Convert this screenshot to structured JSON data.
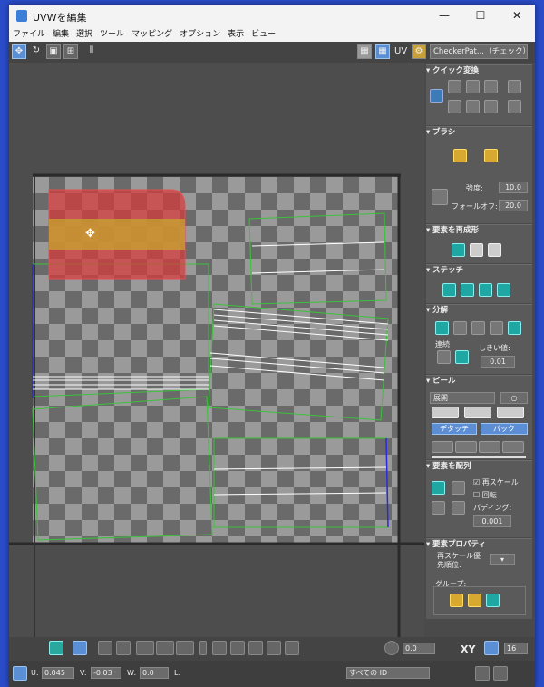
{
  "window": {
    "title": "UVWを編集",
    "min": "—",
    "max": "☐",
    "close": "✕"
  },
  "menu": [
    "ファイル",
    "編集",
    "選択",
    "ツール",
    "マッピング",
    "オプション",
    "表示",
    "ビュー"
  ],
  "toolbar": {
    "uv_label": "UV",
    "checker_dropdown": "CheckerPat...（チェック）"
  },
  "panel": {
    "quick_transform": "クイック変換",
    "brush": "ブラシ",
    "strength_label": "強度:",
    "strength_value": "10.0",
    "falloff_label": "フォールオフ:",
    "falloff_value": "20.0",
    "reshape": "要素を再成形",
    "stitch": "ステッチ",
    "explode": "分解",
    "connect_label": "連続",
    "threshold_label": "しきい値:",
    "threshold_value": "0.01",
    "peel": "ピール",
    "peel_mode": "展開",
    "detach_label": "デタッチ",
    "pack_label": "パック",
    "arrange": "要素を配列",
    "rescale_label": "再スケール",
    "rotate_label": "回転",
    "padding_label": "パディング:",
    "padding_value": "0.001",
    "props": "要素プロパティ",
    "rescale_priority": "再スケール優先順位:",
    "group_label": "グループ:"
  },
  "bottom": {
    "angle_value": "0.0",
    "xy_label": "XY",
    "grid_value": "16",
    "u_label": "U:",
    "u_value": "0.045",
    "v_label": "V:",
    "v_value": "-0.03",
    "w_label": "W:",
    "w_value": "0.0",
    "l_label": "L:",
    "id_dropdown": "すべての ID"
  },
  "colors": {
    "accent": "#5a8fd6",
    "teal": "#29a8a0",
    "uv_edge": "#3cc23c",
    "selection": "#d83a3a"
  }
}
